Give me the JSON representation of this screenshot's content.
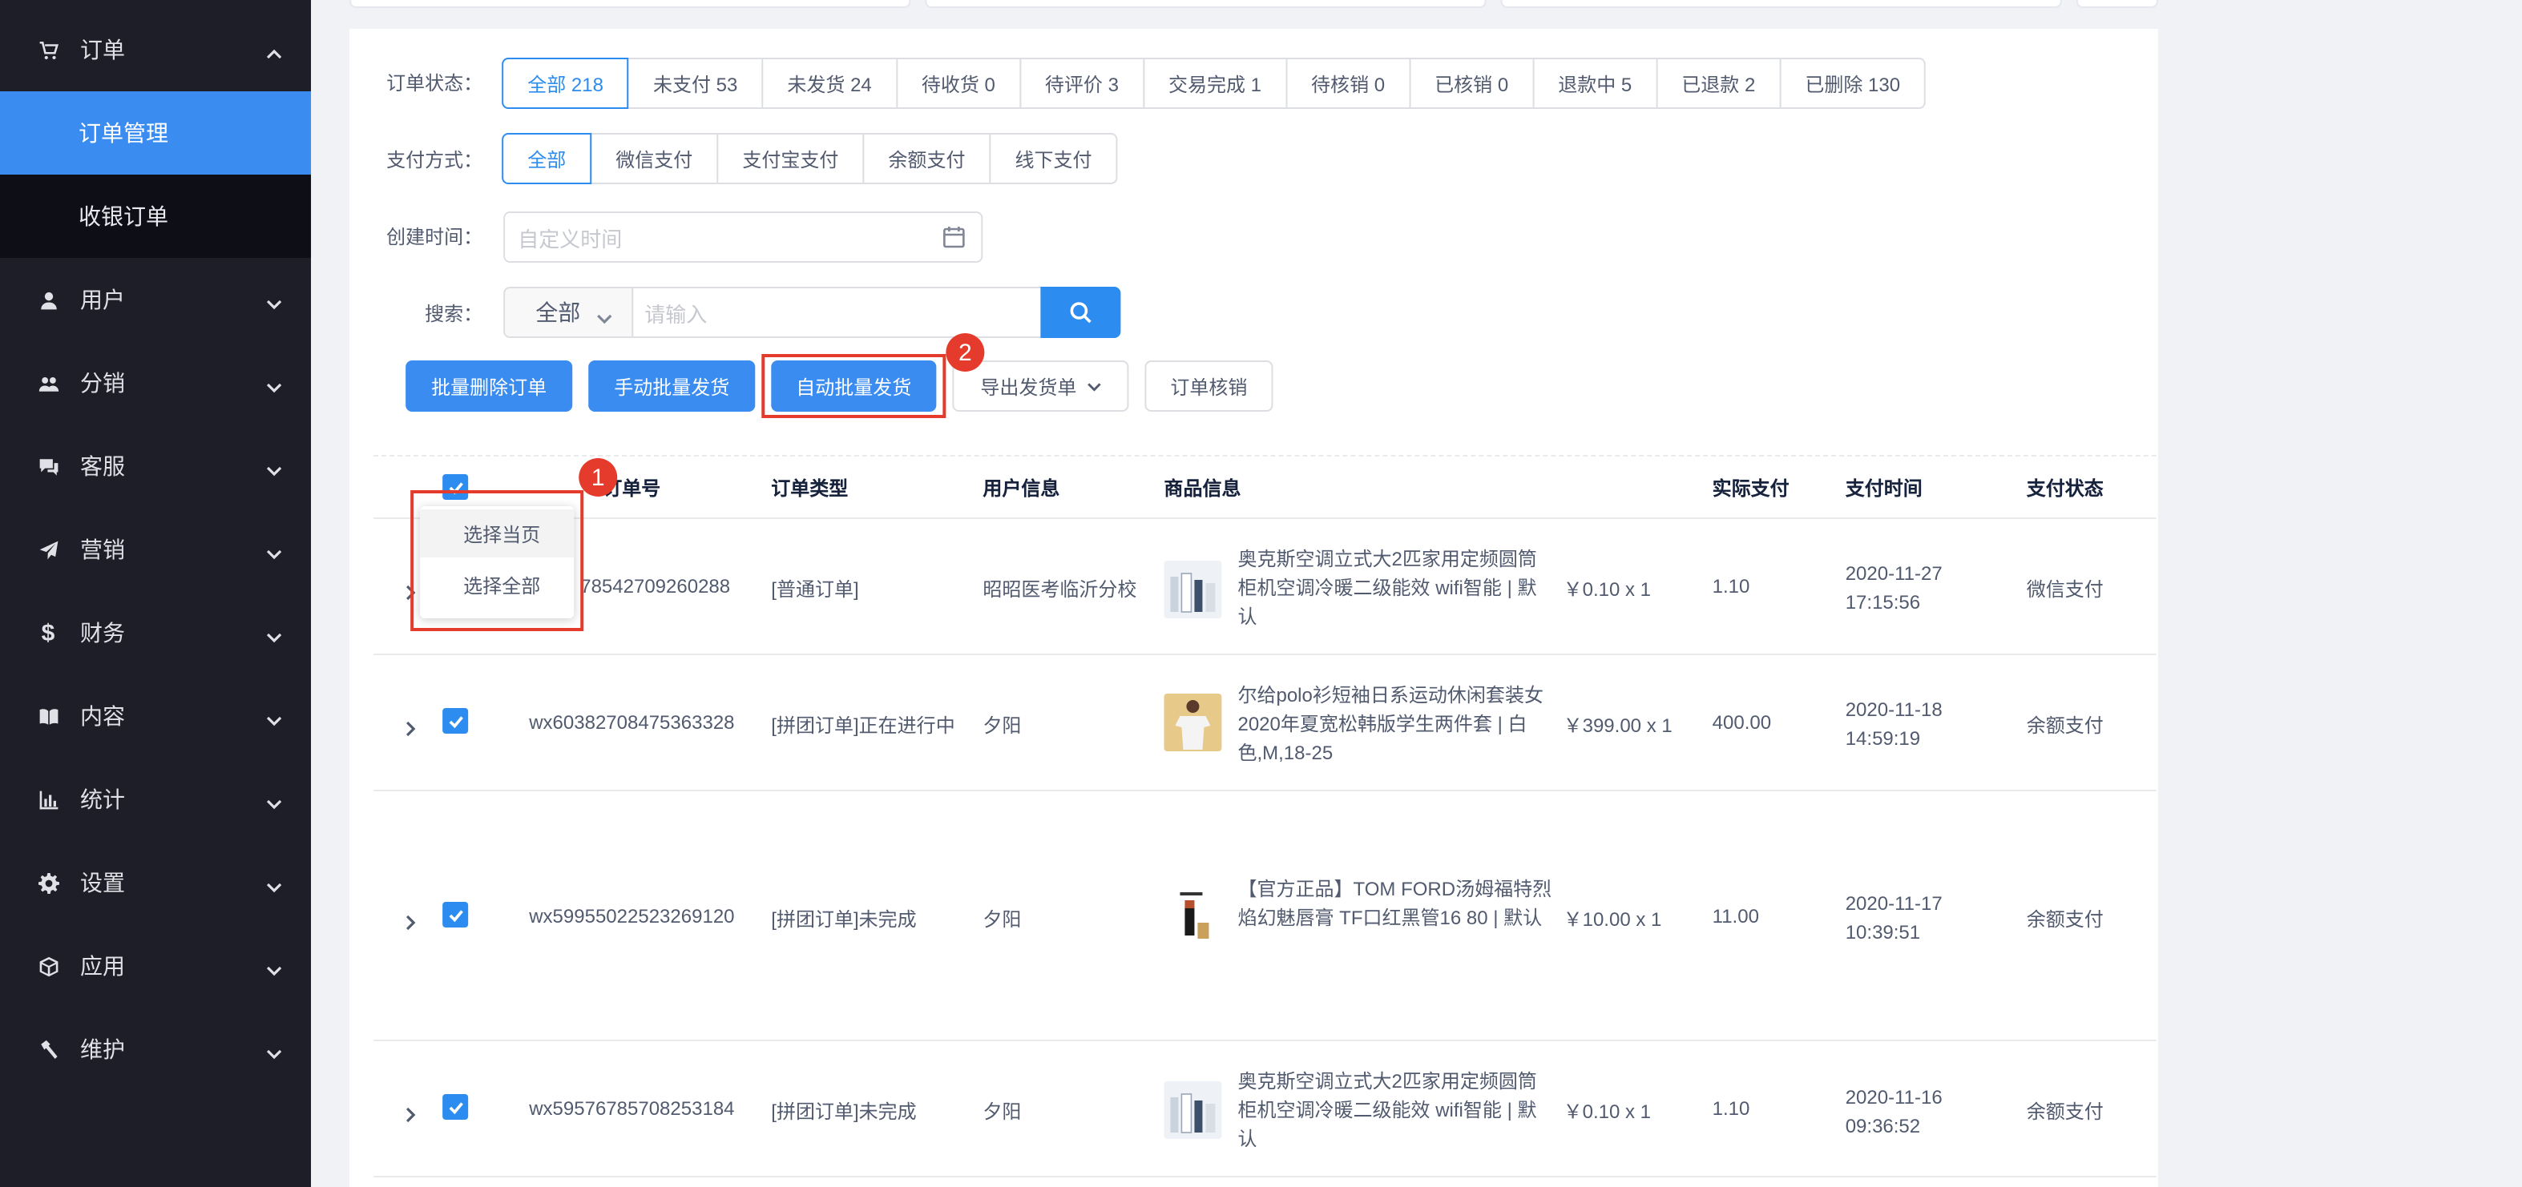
{
  "sidebar": {
    "items": [
      {
        "label": "订单",
        "icon": "cart-icon",
        "expanded": true
      },
      {
        "label": "用户",
        "icon": "user-icon"
      },
      {
        "label": "分销",
        "icon": "group-icon"
      },
      {
        "label": "客服",
        "icon": "chat-icon"
      },
      {
        "label": "营销",
        "icon": "send-icon"
      },
      {
        "label": "财务",
        "icon": "dollar-icon"
      },
      {
        "label": "内容",
        "icon": "book-icon"
      },
      {
        "label": "统计",
        "icon": "bar-chart-icon"
      },
      {
        "label": "设置",
        "icon": "gear-icon"
      },
      {
        "label": "应用",
        "icon": "cube-icon"
      },
      {
        "label": "维护",
        "icon": "hammer-icon"
      }
    ],
    "submenu": [
      {
        "label": "订单管理",
        "active": true
      },
      {
        "label": "收银订单",
        "active": false
      }
    ]
  },
  "filters": {
    "status_label": "订单状态：",
    "status_options": [
      "全部 218",
      "未支付 53",
      "未发货 24",
      "待收货 0",
      "待评价 3",
      "交易完成 1",
      "待核销 0",
      "已核销 0",
      "退款中 5",
      "已退款 2",
      "已删除 130"
    ],
    "payment_label": "支付方式：",
    "payment_options": [
      "全部",
      "微信支付",
      "支付宝支付",
      "余额支付",
      "线下支付"
    ],
    "time_label": "创建时间：",
    "time_placeholder": "自定义时间",
    "search_label": "搜索：",
    "search_select": "全部",
    "search_placeholder": "请输入"
  },
  "actions": {
    "batch_delete": "批量删除订单",
    "manual_ship": "手动批量发货",
    "auto_ship": "自动批量发货",
    "export": "导出发货单",
    "verify": "订单核销"
  },
  "annotations": {
    "badge1": "1",
    "badge2": "2"
  },
  "select_menu": {
    "current_page": "选择当页",
    "all": "选择全部"
  },
  "table": {
    "headers": {
      "order_no": "订单号",
      "order_type": "订单类型",
      "user_info": "用户信息",
      "product_info": "商品信息",
      "paid": "实际支付",
      "pay_time": "支付时间",
      "pay_status": "支付状态"
    },
    "rows": [
      {
        "order_no": "wx1606478542709260288",
        "order_no_visible": "78542709260288",
        "type": "[普通订单]",
        "user": "昭昭医考临沂分校",
        "product": "奥克斯空调立式大2匹家用定频圆筒柜机空调冷暖二级能效 wifi智能 | 默认",
        "price": "￥0.10 x 1",
        "paid": "1.10",
        "time": "2020-11-27 17:15:56",
        "status": "微信支付"
      },
      {
        "order_no": "wx60382708475363328",
        "type": "[拼团订单]正在进行中",
        "user": "夕阳",
        "product": "尔给polo衫短袖日系运动休闲套装女2020年夏宽松韩版学生两件套 | 白色,M,18-25",
        "price": "￥399.00 x 1",
        "paid": "400.00",
        "time": "2020-11-18 14:59:19",
        "status": "余额支付"
      },
      {
        "order_no": "wx59955022523269120",
        "type": "[拼团订单]未完成",
        "user": "夕阳",
        "product": "【官方正品】TOM FORD汤姆福特烈焰幻魅唇膏 TF口红黑管16 80 | 默认",
        "price": "￥10.00 x 1",
        "paid": "11.00",
        "time": "2020-11-17 10:39:51",
        "status": "余额支付"
      },
      {
        "order_no": "wx59576785708253184",
        "type": "[拼团订单]未完成",
        "user": "夕阳",
        "product": "奥克斯空调立式大2匹家用定频圆筒柜机空调冷暖二级能效 wifi智能 | 默认",
        "price": "￥0.10 x 1",
        "paid": "1.10",
        "time": "2020-11-16 09:36:52",
        "status": "余额支付"
      }
    ]
  },
  "colors": {
    "primary": "#2d8cf0",
    "sidebar_bg": "#1d1e27",
    "annotation_red": "#e53b2c"
  }
}
